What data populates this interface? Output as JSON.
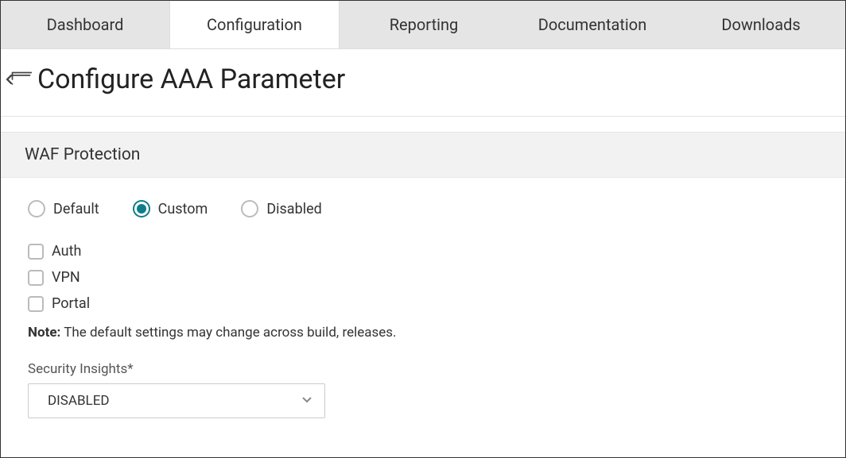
{
  "tabs": [
    {
      "label": "Dashboard",
      "active": false
    },
    {
      "label": "Configuration",
      "active": true
    },
    {
      "label": "Reporting",
      "active": false
    },
    {
      "label": "Documentation",
      "active": false
    },
    {
      "label": "Downloads",
      "active": false
    }
  ],
  "page": {
    "title": "Configure AAA Parameter"
  },
  "section": {
    "title": "WAF Protection",
    "radios": [
      {
        "label": "Default",
        "selected": false
      },
      {
        "label": "Custom",
        "selected": true
      },
      {
        "label": "Disabled",
        "selected": false
      }
    ],
    "checks": [
      {
        "label": "Auth",
        "checked": false
      },
      {
        "label": "VPN",
        "checked": false
      },
      {
        "label": "Portal",
        "checked": false
      }
    ],
    "note_prefix": "Note:",
    "note_text": " The default settings may change across build, releases.",
    "security_insights": {
      "label": "Security Insights*",
      "value": "DISABLED"
    }
  }
}
